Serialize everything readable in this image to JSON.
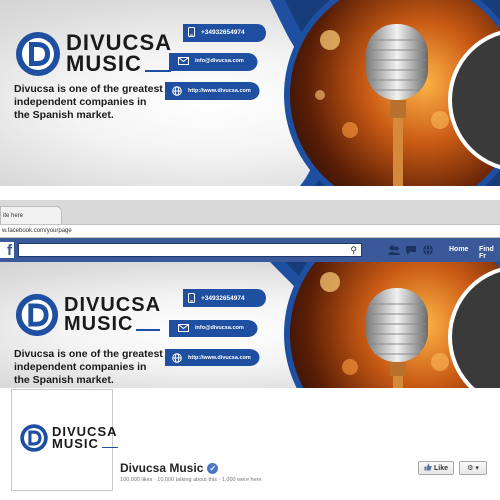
{
  "cover": {
    "brand_line1": "DIVUCSA",
    "brand_line2": "MUSIC",
    "tagline": "Divucsa is one of the greatest independent companies in the Spanish market.",
    "phone": "+34932654974",
    "email": "info@divucsa.com",
    "website": "http://www.divucsa.com",
    "colors": {
      "accent_blue": "#1f4fa0",
      "dark_blue": "#163c7a",
      "bg_gray": "#dcdcdc"
    }
  },
  "browser": {
    "tab_title": "ite here",
    "url": "w.facebook.com/yourpage"
  },
  "facebook": {
    "logo_letter": "f",
    "nav_home": "Home",
    "nav_find": "Find Fr",
    "page_name": "Divucsa Music",
    "stats": "100,000 likes · 10,000 talking about this · 1,000 were here",
    "like_label": "Like",
    "colors": {
      "fb_blue": "#3b5998"
    }
  }
}
